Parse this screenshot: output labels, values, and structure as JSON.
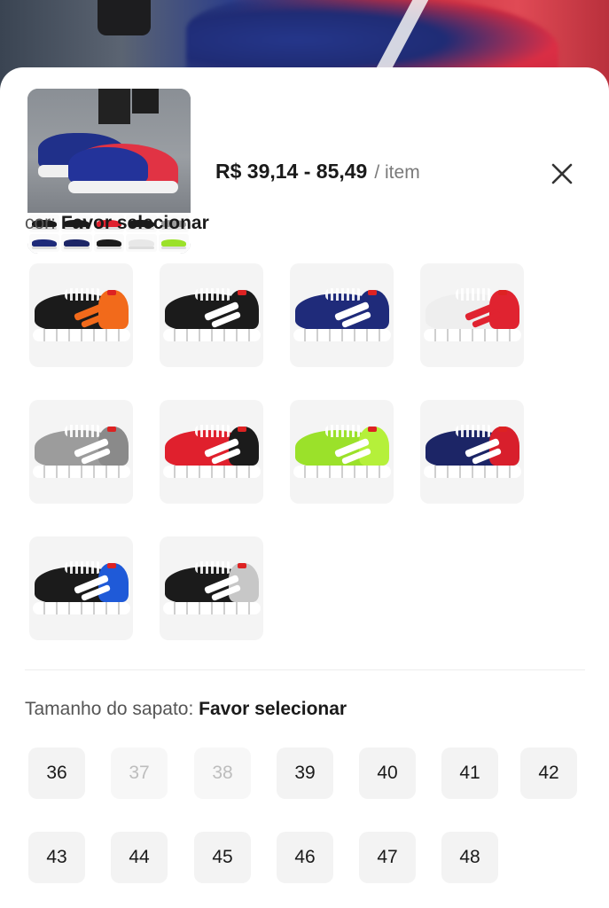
{
  "header": {
    "price": "R$ 39,14 - 85,49",
    "unit": "/ item",
    "close_icon": "close-icon"
  },
  "color_section": {
    "label": "cor:",
    "value": "Favor selecionar",
    "options": [
      {
        "name": "black-orange",
        "main": "#1b1b1b",
        "accent": "#f26a1b",
        "stripe": "#f26a1b",
        "sole": "#ffffff"
      },
      {
        "name": "black-white",
        "main": "#1b1b1b",
        "accent": "#1b1b1b",
        "stripe": "#ffffff",
        "sole": "#ffffff"
      },
      {
        "name": "navy-white",
        "main": "#1f2b7a",
        "accent": "#1f2b7a",
        "stripe": "#ffffff",
        "sole": "#ffffff"
      },
      {
        "name": "white-red",
        "main": "#eeeeee",
        "accent": "#e02330",
        "stripe": "#e02330",
        "sole": "#ffffff"
      },
      {
        "name": "gray-white",
        "main": "#9c9c9c",
        "accent": "#8a8a8a",
        "stripe": "#ffffff",
        "sole": "#ffffff"
      },
      {
        "name": "red-black",
        "main": "#e0202d",
        "accent": "#1b1b1b",
        "stripe": "#ffffff",
        "sole": "#ffffff"
      },
      {
        "name": "neon-green",
        "main": "#9be12a",
        "accent": "#b5f03a",
        "stripe": "#ffffff",
        "sole": "#ffffff"
      },
      {
        "name": "navy-red",
        "main": "#1c2566",
        "accent": "#d81f2c",
        "stripe": "#ffffff",
        "sole": "#ffffff"
      },
      {
        "name": "black-blue",
        "main": "#1b1b1b",
        "accent": "#1f5ad8",
        "stripe": "#ffffff",
        "sole": "#ffffff"
      },
      {
        "name": "black-gray",
        "main": "#1b1b1b",
        "accent": "#c7c7c7",
        "stripe": "#ffffff",
        "sole": "#ffffff"
      }
    ]
  },
  "size_section": {
    "label": "Tamanho do sapato:",
    "value": "Favor selecionar",
    "sizes": [
      {
        "label": "36",
        "available": true
      },
      {
        "label": "37",
        "available": false
      },
      {
        "label": "38",
        "available": false
      },
      {
        "label": "39",
        "available": true
      },
      {
        "label": "40",
        "available": true
      },
      {
        "label": "41",
        "available": true
      },
      {
        "label": "42",
        "available": true
      },
      {
        "label": "43",
        "available": true
      },
      {
        "label": "44",
        "available": true
      },
      {
        "label": "45",
        "available": true
      },
      {
        "label": "46",
        "available": true
      },
      {
        "label": "47",
        "available": true
      },
      {
        "label": "48",
        "available": true
      }
    ]
  },
  "thumbnail_strip_colors": [
    "#1b1b1b",
    "#1b1b1b",
    "#e0202d",
    "#1b1b1b",
    "#9c9c9c",
    "#1f2b7a",
    "#1c2566",
    "#1b1b1b",
    "#e8e8e8",
    "#9be12a"
  ]
}
